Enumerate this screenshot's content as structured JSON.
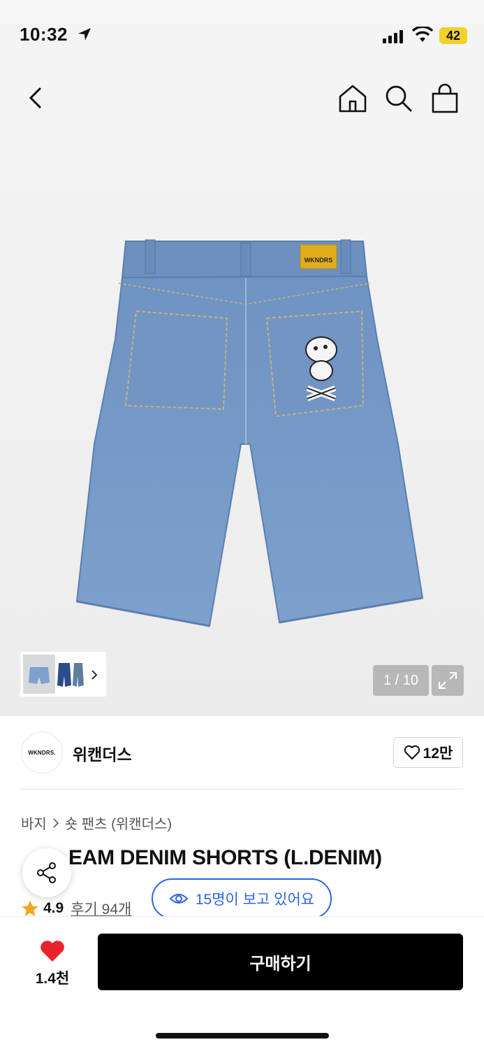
{
  "status": {
    "time": "10:32",
    "battery": "42"
  },
  "gallery": {
    "counter": "1 / 10",
    "patch_text": "WKNDRS"
  },
  "brand": {
    "logo_text": "WKNDRS.",
    "name": "위캔더스",
    "likes": "12만"
  },
  "breadcrumb": {
    "category": "바지",
    "subcategory": "숏 팬츠 (위캔더스)"
  },
  "product": {
    "title": "EAM DENIM SHORTS (L.DENIM)"
  },
  "rating": {
    "score": "4.9",
    "reviews": "후기 94개"
  },
  "viewers": {
    "text": "15명이 보고 있어요"
  },
  "bottom": {
    "wish_count": "1.4천",
    "buy_label": "구매하기"
  },
  "colors": {
    "accent_blue": "#2c66e0",
    "heart_red": "#e8232a",
    "star": "#f5a623",
    "buy_bg": "#000000"
  }
}
